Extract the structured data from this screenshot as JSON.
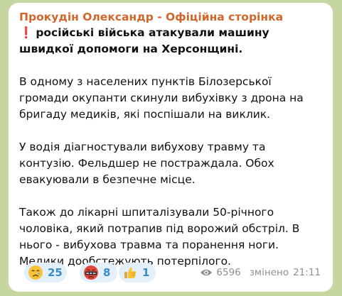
{
  "post": {
    "author": "Прокудін Олександр - Офіційна сторінка",
    "headline_mark": "❗",
    "headline": "російські війська атакували машину швидкої допомоги на Херсонщині.",
    "paragraphs": [
      "В одному з населених пунктів Білозерської громади окупанти скинули вибухівку з дрона на бригаду медиків, які поспішали на виклик.",
      "У водія діагностували вибухову травму та контузію. Фельдшер не постраждала. Обох евакуювали в безпечне місце.",
      "Також до лікарні шпиталізували 50-річного чоловіка, який потрапив під ворожий обстріл. В нього - вибухова травма та поранення ноги. Медики дообстежують потерпілого."
    ]
  },
  "reactions": [
    {
      "icon": "crying-face-icon",
      "count": "25"
    },
    {
      "icon": "angry-face-icon",
      "count": "8"
    },
    {
      "icon": "thumbs-up-icon",
      "count": "1"
    }
  ],
  "meta": {
    "views": "6596",
    "edited_label": "змінено",
    "time": "21:11"
  },
  "colors": {
    "background": "#c6d6a0",
    "author": "#d0662b",
    "reaction_bg": "#e3f0f9",
    "reaction_count": "#3a8ac7",
    "meta": "#8a9298"
  }
}
